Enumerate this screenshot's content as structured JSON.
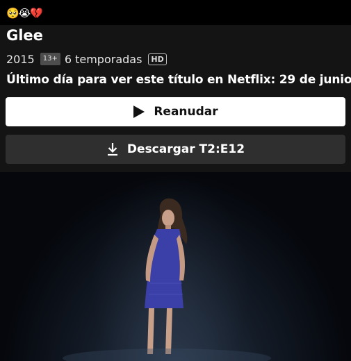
{
  "status_bar": {
    "emojis": "🥺😭💔"
  },
  "show": {
    "title": "Glee",
    "year": "2015",
    "rating": "13+",
    "seasons": "6 temporadas",
    "quality": "HD",
    "notice": "Último día para ver este título en Netflix: 29 de junio"
  },
  "actions": {
    "play_label": "Reanudar",
    "play_icon": "play-icon",
    "download_label": "Descargar T2:E12",
    "download_icon": "download-icon"
  },
  "colors": {
    "background": "#000000",
    "panel": "#141414",
    "play_button": "#ffffff",
    "download_button": "#2f2f2f"
  }
}
